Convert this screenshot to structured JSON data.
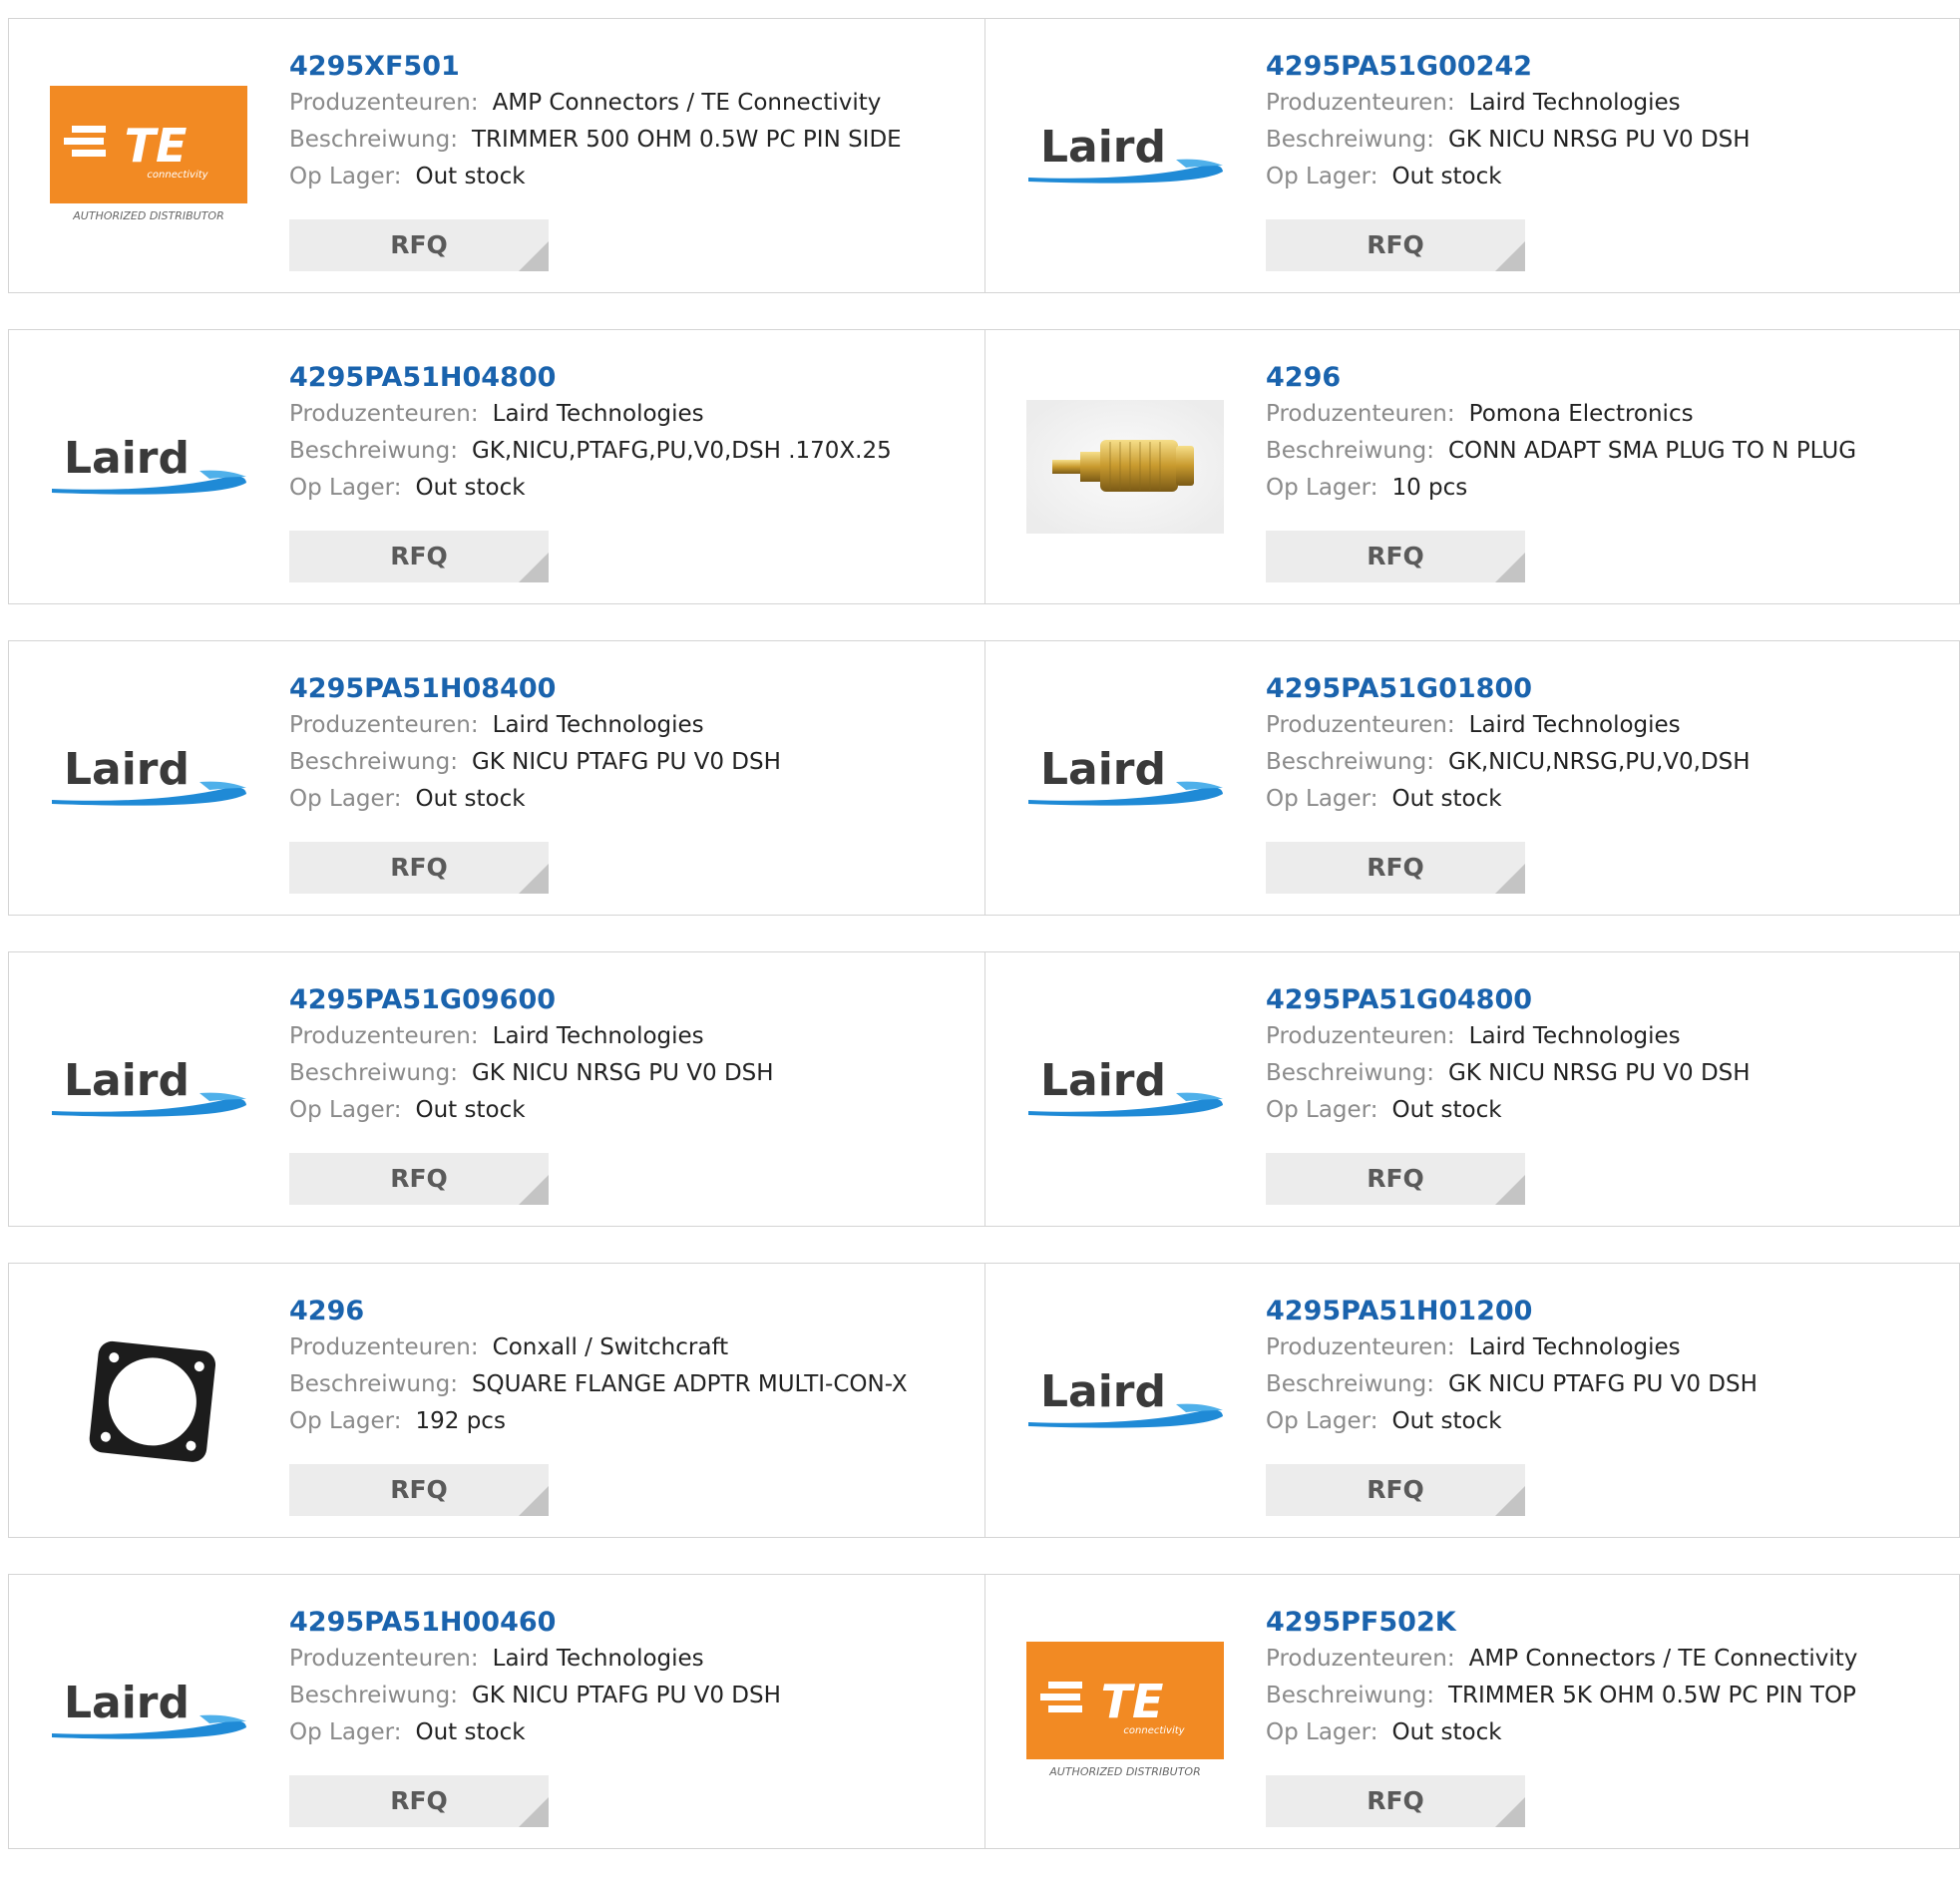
{
  "labels": {
    "manufacturer": "Produzenteuren:",
    "description": "Beschreiwung:",
    "stock": "Op Lager:",
    "rfq": "RFQ"
  },
  "colors": {
    "part_link": "#1a63ad",
    "te_orange": "#f28a23",
    "laird_blue": "#1f8ad6",
    "laird_text": "#3a3a3a"
  },
  "logo_text": {
    "te": "TE",
    "te_sub": "connectivity",
    "te_tag": "AUTHORIZED DISTRIBUTOR",
    "laird": "Laird"
  },
  "products": [
    {
      "part": "4295XF501",
      "manufacturer": "AMP Connectors / TE Connectivity",
      "description": "TRIMMER 500 OHM 0.5W PC PIN SIDE",
      "stock": "Out stock",
      "logo": "te"
    },
    {
      "part": "4295PA51G00242",
      "manufacturer": "Laird Technologies",
      "description": "GK NICU NRSG PU V0 DSH",
      "stock": "Out stock",
      "logo": "laird"
    },
    {
      "part": "4295PA51H04800",
      "manufacturer": "Laird Technologies",
      "description": "GK,NICU,PTAFG,PU,V0,DSH .170X.25",
      "stock": "Out stock",
      "logo": "laird"
    },
    {
      "part": "4296",
      "manufacturer": "Pomona Electronics",
      "description": "CONN ADAPT SMA PLUG TO N PLUG",
      "stock": "10 pcs",
      "logo": "sma-adapter"
    },
    {
      "part": "4295PA51H08400",
      "manufacturer": "Laird Technologies",
      "description": "GK NICU PTAFG PU V0 DSH",
      "stock": "Out stock",
      "logo": "laird"
    },
    {
      "part": "4295PA51G01800",
      "manufacturer": "Laird Technologies",
      "description": "GK,NICU,NRSG,PU,V0,DSH",
      "stock": "Out stock",
      "logo": "laird"
    },
    {
      "part": "4295PA51G09600",
      "manufacturer": "Laird Technologies",
      "description": "GK NICU NRSG PU V0 DSH",
      "stock": "Out stock",
      "logo": "laird"
    },
    {
      "part": "4295PA51G04800",
      "manufacturer": "Laird Technologies",
      "description": "GK NICU NRSG PU V0 DSH",
      "stock": "Out stock",
      "logo": "laird"
    },
    {
      "part": "4296",
      "manufacturer": "Conxall / Switchcraft",
      "description": "SQUARE FLANGE ADPTR MULTI-CON-X",
      "stock": "192 pcs",
      "logo": "flange"
    },
    {
      "part": "4295PA51H01200",
      "manufacturer": "Laird Technologies",
      "description": "GK NICU PTAFG PU V0 DSH",
      "stock": "Out stock",
      "logo": "laird"
    },
    {
      "part": "4295PA51H00460",
      "manufacturer": "Laird Technologies",
      "description": "GK NICU PTAFG PU V0 DSH",
      "stock": "Out stock",
      "logo": "laird"
    },
    {
      "part": "4295PF502K",
      "manufacturer": "AMP Connectors / TE Connectivity",
      "description": "TRIMMER 5K OHM 0.5W PC PIN TOP",
      "stock": "Out stock",
      "logo": "te"
    }
  ]
}
